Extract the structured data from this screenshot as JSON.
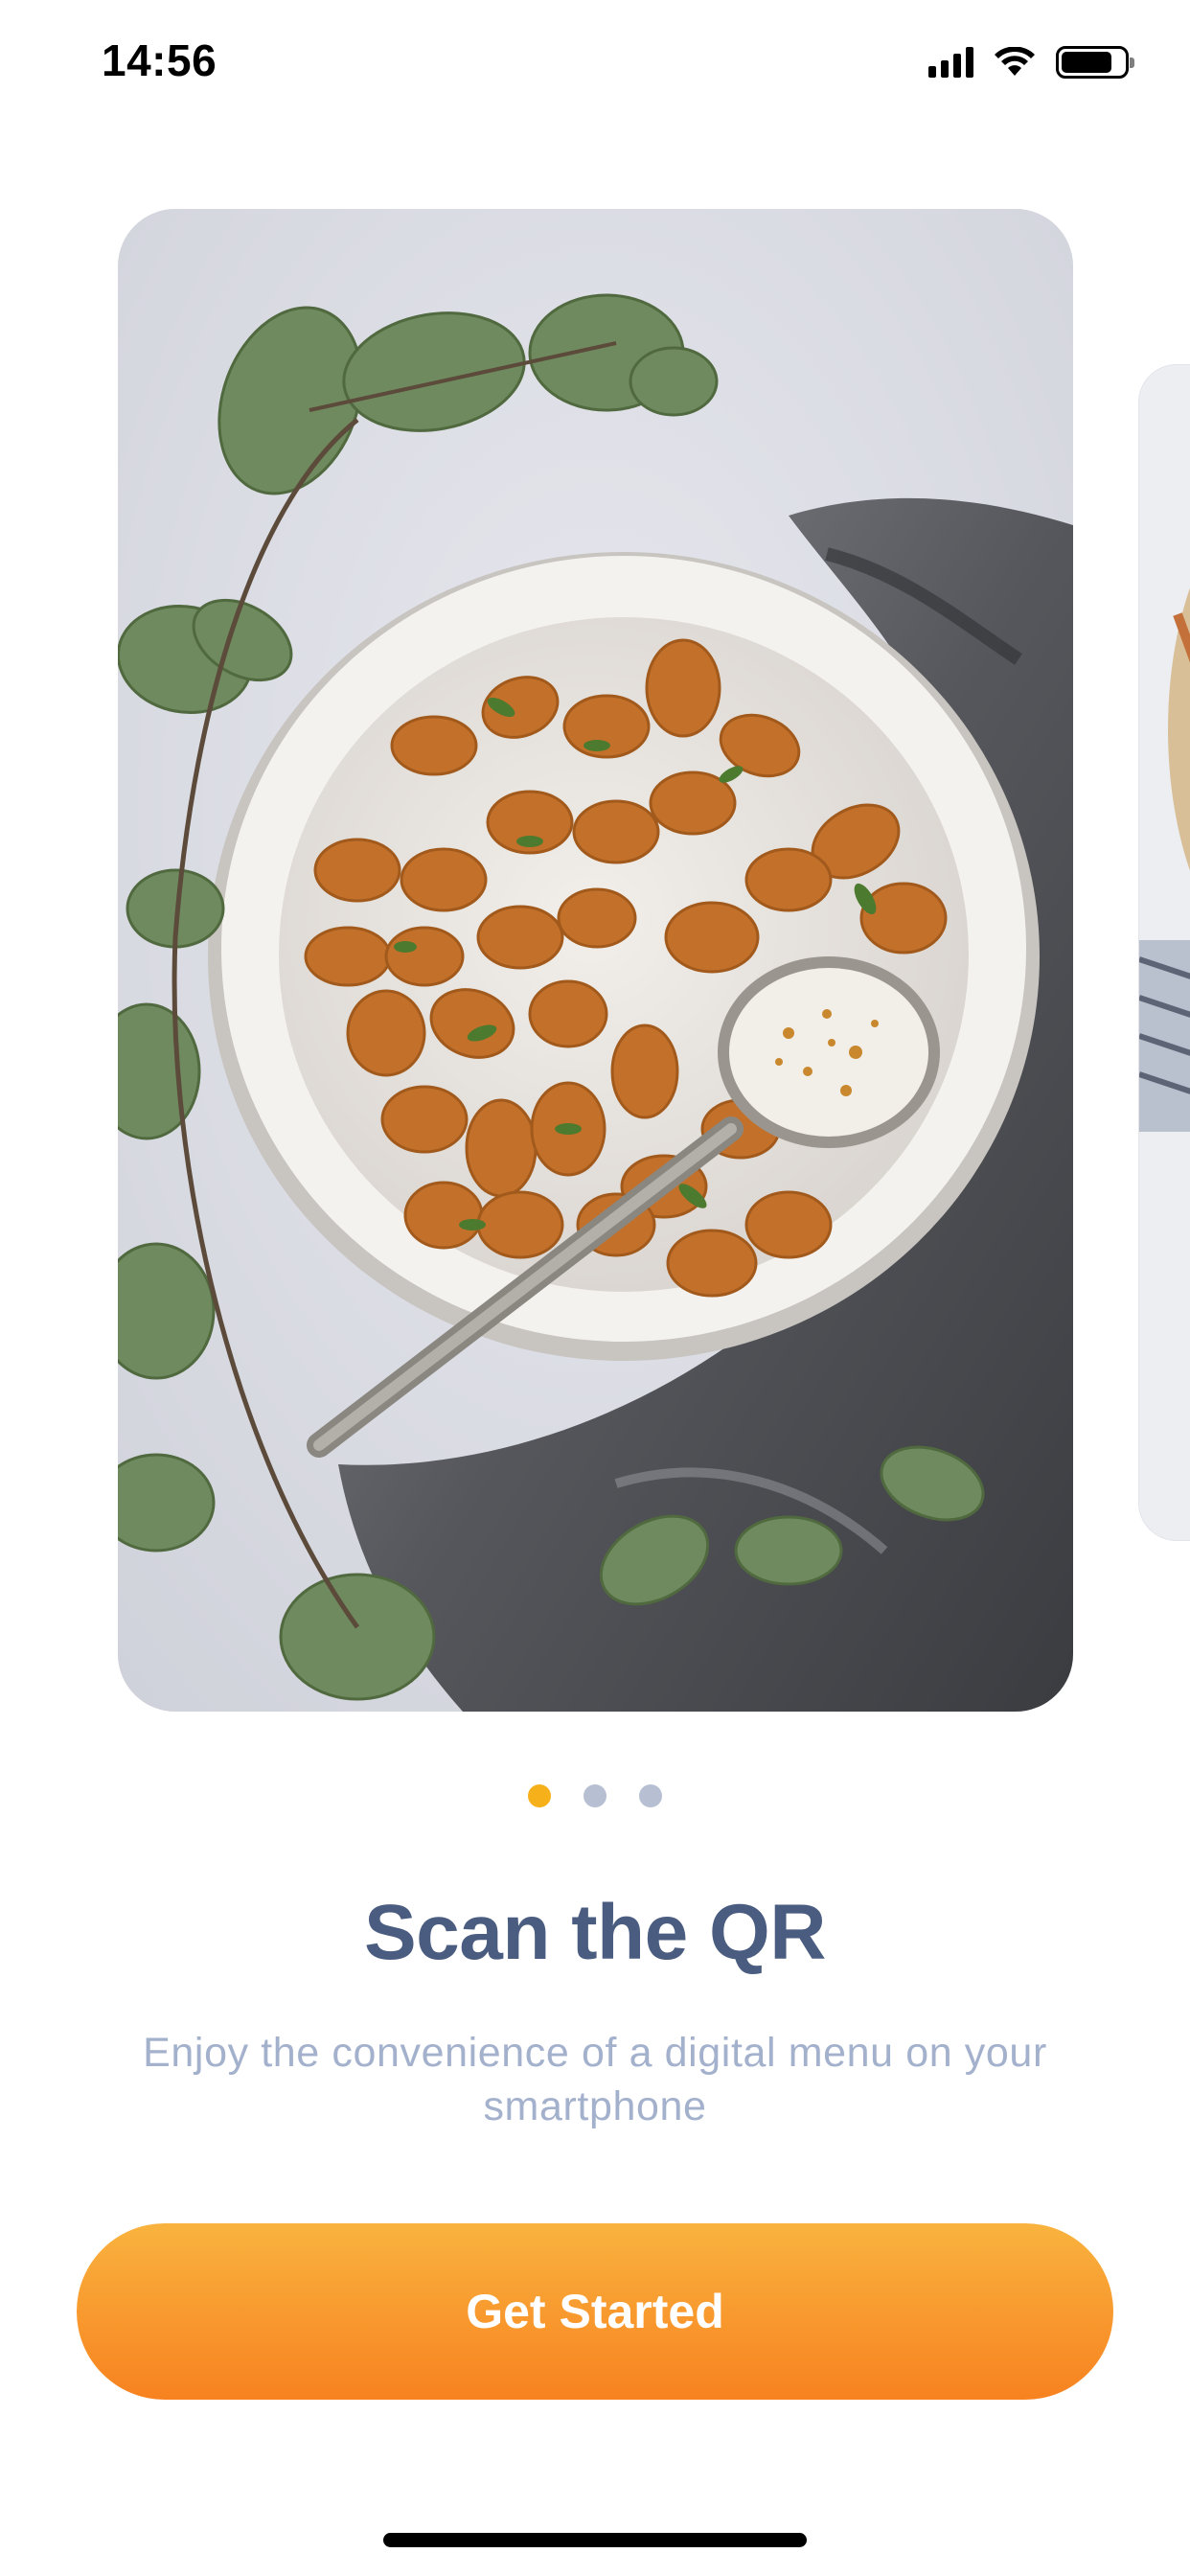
{
  "status_bar": {
    "time": "14:56",
    "icons": [
      "cellular-signal-icon",
      "wifi-icon",
      "battery-icon"
    ]
  },
  "carousel": {
    "slides": [
      {
        "image": "food-photo-gnocchi-bowl",
        "active": true
      },
      {
        "image": "food-photo-next-slide",
        "active": false
      }
    ],
    "page_count": 3,
    "current_page": 1
  },
  "onboarding": {
    "title": "Scan the QR",
    "subtitle": "Enjoy the convenience of a digital menu on your smartphone"
  },
  "cta": {
    "label": "Get Started"
  },
  "colors": {
    "accent": "#f6b01a",
    "button_top": "#f9b33f",
    "button_bottom": "#f7821f",
    "title": "#4a5c80",
    "subtitle": "#a3b1cd",
    "dot_inactive": "#b7c0d3"
  }
}
